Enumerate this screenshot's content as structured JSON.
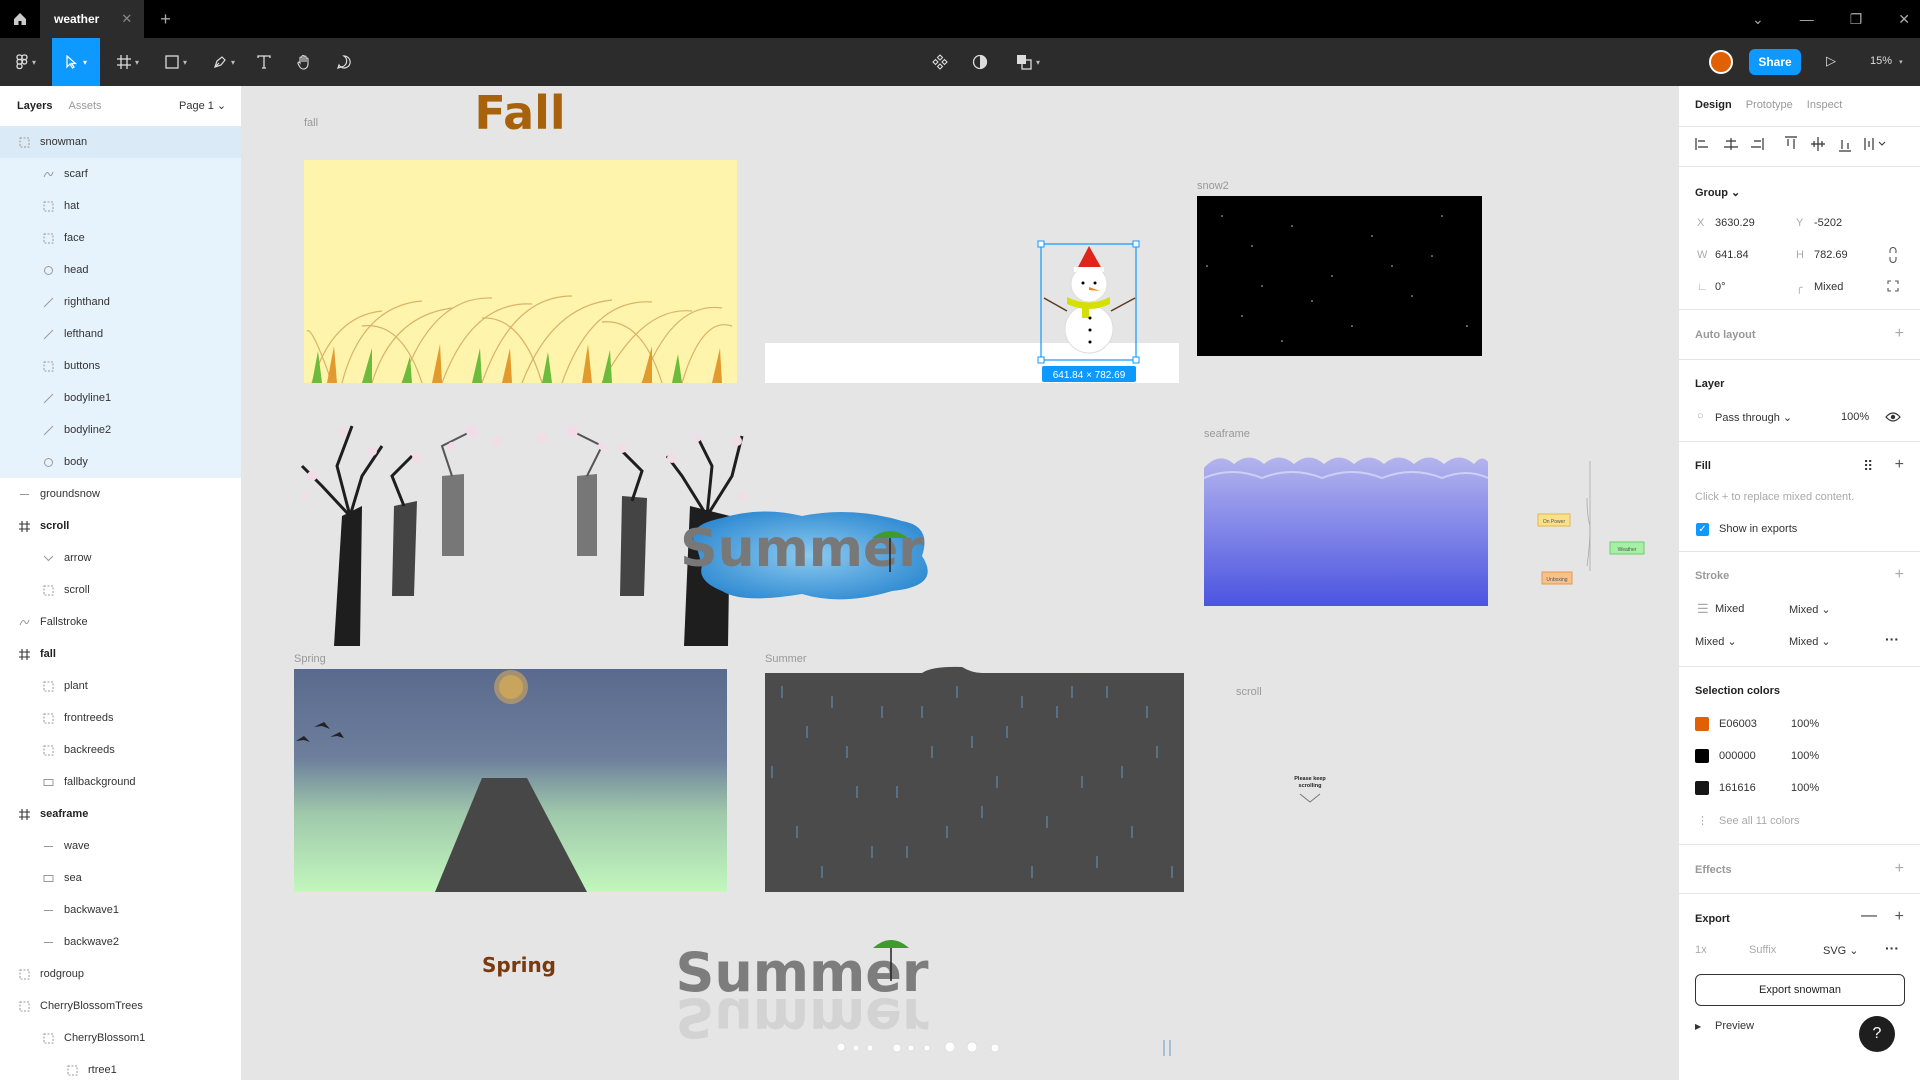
{
  "titlebar": {
    "doc_tab": "weather",
    "close": "✕",
    "new_tab": "+",
    "controls": [
      "⌄",
      "—",
      "❐",
      "✕"
    ]
  },
  "toolbar": {
    "share_label": "Share",
    "zoom_label": "15%"
  },
  "left_panel": {
    "tabs": [
      "Layers",
      "Assets"
    ],
    "page_selector": "Page 1 ⌄",
    "layers": [
      {
        "label": "snowman",
        "indent": 0,
        "icon": "dashed-frame"
      },
      {
        "label": "scarf",
        "indent": 1,
        "icon": "vector"
      },
      {
        "label": "hat",
        "indent": 1,
        "icon": "dashed-frame"
      },
      {
        "label": "face",
        "indent": 1,
        "icon": "dashed-frame"
      },
      {
        "label": "head",
        "indent": 1,
        "icon": "ellipse"
      },
      {
        "label": "righthand",
        "indent": 1,
        "icon": "line"
      },
      {
        "label": "lefthand",
        "indent": 1,
        "icon": "line"
      },
      {
        "label": "buttons",
        "indent": 1,
        "icon": "dashed-frame"
      },
      {
        "label": "bodyline1",
        "indent": 1,
        "icon": "line"
      },
      {
        "label": "bodyline2",
        "indent": 1,
        "icon": "line"
      },
      {
        "label": "body",
        "indent": 1,
        "icon": "ellipse"
      },
      {
        "label": "groundsnow",
        "indent": 0,
        "icon": "dash"
      },
      {
        "label": "scroll",
        "indent": 0,
        "icon": "frame"
      },
      {
        "label": "arrow",
        "indent": 1,
        "icon": "chevron"
      },
      {
        "label": "scroll",
        "indent": 1,
        "icon": "dashed-frame"
      },
      {
        "label": "Fallstroke",
        "indent": 0,
        "icon": "vector"
      },
      {
        "label": "fall",
        "indent": 0,
        "icon": "frame"
      },
      {
        "label": "plant",
        "indent": 1,
        "icon": "dashed-frame"
      },
      {
        "label": "frontreeds",
        "indent": 1,
        "icon": "dashed-frame"
      },
      {
        "label": "backreeds",
        "indent": 1,
        "icon": "dashed-frame"
      },
      {
        "label": "fallbackground",
        "indent": 1,
        "icon": "rect"
      },
      {
        "label": "seaframe",
        "indent": 0,
        "icon": "frame"
      },
      {
        "label": "wave",
        "indent": 1,
        "icon": "dash"
      },
      {
        "label": "sea",
        "indent": 1,
        "icon": "rect"
      },
      {
        "label": "backwave1",
        "indent": 1,
        "icon": "dash"
      },
      {
        "label": "backwave2",
        "indent": 1,
        "icon": "dash"
      },
      {
        "label": "rodgroup",
        "indent": 0,
        "icon": "dashed-frame"
      },
      {
        "label": "CherryBlossomTrees",
        "indent": 0,
        "icon": "dashed-frame"
      },
      {
        "label": "CherryBlossom1",
        "indent": 1,
        "icon": "dashed-frame"
      },
      {
        "label": "rtree1",
        "indent": 2,
        "icon": "dashed-frame"
      }
    ]
  },
  "canvas": {
    "fall_title": "Fall",
    "label_fall": "fall",
    "label_snow2": "snow2",
    "label_seaframe": "seaframe",
    "label_spring": "Spring",
    "label_summer": "Summer",
    "label_scroll": "scroll",
    "selection_size": "641.84 × 782.69",
    "summer_word": "Summer",
    "spring_word": "Spring",
    "scroll_text1": "Please keep",
    "scroll_text2": "scrolling",
    "flow_labels": [
      "On Power",
      "Weather",
      "Unboxing"
    ]
  },
  "right_panel": {
    "tabs": [
      "Design",
      "Prototype",
      "Inspect"
    ],
    "group_label": "Group ⌄",
    "x_label": "X",
    "x_value": "3630.29",
    "y_label": "Y",
    "y_value": "-5202",
    "w_label": "W",
    "w_value": "641.84",
    "h_label": "H",
    "h_value": "782.69",
    "rotation": "0°",
    "radius": "Mixed",
    "auto_layout": "Auto layout",
    "layer_title": "Layer",
    "blend": "Pass through ⌄",
    "opacity": "100%",
    "fill_title": "Fill",
    "fill_hint": "Click + to replace mixed content.",
    "show_exports": "Show in exports",
    "stroke_title": "Stroke",
    "stroke_mixed1": "Mixed",
    "stroke_mixed2": "Mixed ⌄",
    "stroke_mixed3": "Mixed ⌄",
    "stroke_mixed4": "Mixed ⌄",
    "selection_colors_title": "Selection colors",
    "colors": [
      {
        "hex": "E06003",
        "pct": "100%",
        "swatch": "#E06003"
      },
      {
        "hex": "000000",
        "pct": "100%",
        "swatch": "#000000"
      },
      {
        "hex": "161616",
        "pct": "100%",
        "swatch": "#161616"
      }
    ],
    "see_all": "See all 11 colors",
    "effects_title": "Effects",
    "export_title": "Export",
    "export_scale": "1x",
    "export_suffix": "Suffix",
    "export_format": "SVG ⌄",
    "export_button": "Export snowman",
    "preview": "Preview",
    "help": "?"
  },
  "accent_color": "#0d99ff"
}
